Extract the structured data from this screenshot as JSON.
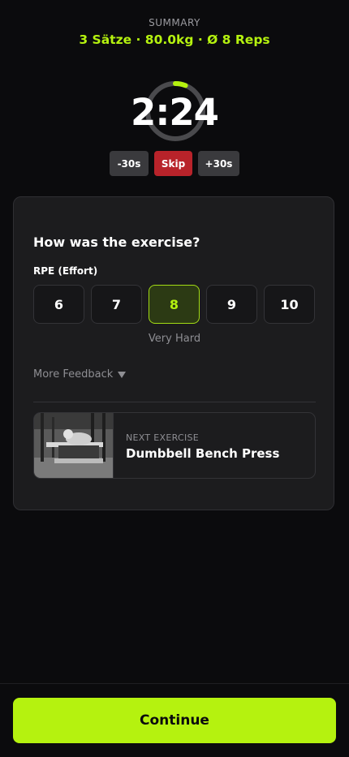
{
  "summary": {
    "label": "SUMMARY",
    "stats": "3 Sätze · 80.0kg · Ø 8 Reps"
  },
  "timer": {
    "value": "2:24",
    "progress_fraction": 0.06,
    "buttons": {
      "minus": "-30s",
      "skip": "Skip",
      "plus": "+30s"
    }
  },
  "feedback": {
    "title": "How was the exercise?",
    "rpe_label": "RPE (Effort)",
    "rpe_options": [
      "6",
      "7",
      "8",
      "9",
      "10"
    ],
    "selected": "8",
    "selected_description": "Very Hard",
    "more_feedback": "More Feedback"
  },
  "next_exercise": {
    "label": "NEXT EXERCISE",
    "name": "Dumbbell Bench Press",
    "thumbnail": "bench-press-photo"
  },
  "footer": {
    "continue_label": "Continue"
  },
  "colors": {
    "accent": "#b5f20f",
    "skip": "#b8232a",
    "background": "#0b0b0d",
    "card": "#1c1c1e"
  }
}
